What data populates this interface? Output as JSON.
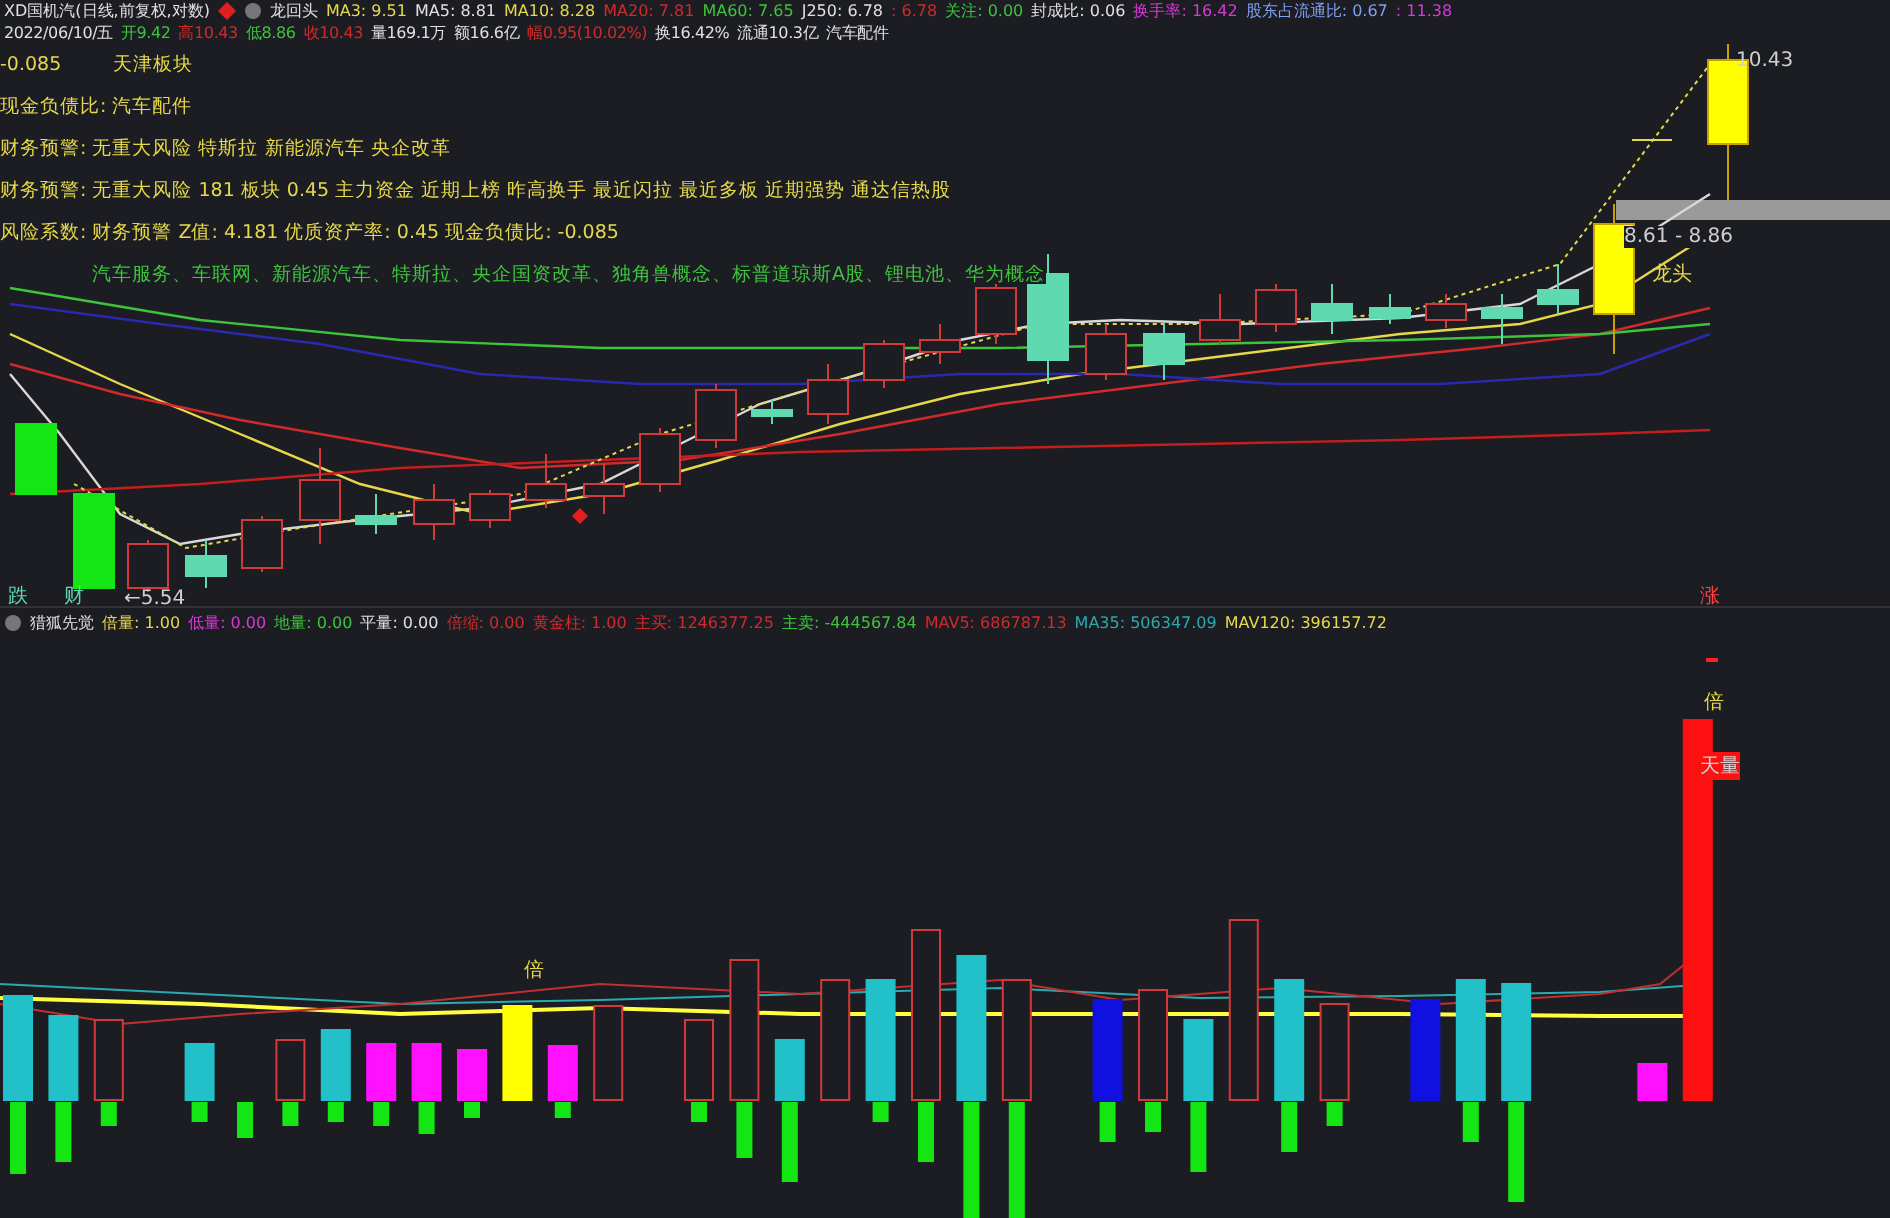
{
  "quote_bar": {
    "title": "XD国机汽(日线,前复权,对数)",
    "indicator": "龙回头",
    "items": [
      {
        "text": "MA3: 9.51",
        "color": "#e6d84a"
      },
      {
        "text": "MA5: 8.81",
        "color": "#e0e0e0"
      },
      {
        "text": "MA10: 8.28",
        "color": "#e6d84a"
      },
      {
        "text": "MA20: 7.81",
        "color": "#d02a2a"
      },
      {
        "text": "MA60: 7.65",
        "color": "#3cc43c"
      },
      {
        "text": "J250: 6.78",
        "color": "#e0e0e0"
      },
      {
        "text": ": 6.78",
        "color": "#d02a2a"
      },
      {
        "text": "关注: 0.00",
        "color": "#3cc43c"
      },
      {
        "text": "封成比: 0.06",
        "color": "#e0e0e0"
      },
      {
        "text": "换手率: 16.42",
        "color": "#d838d8"
      },
      {
        "text": "股东占流通比: 0.67",
        "color": "#7f9ff0"
      },
      {
        "text": ": 11.38",
        "color": "#d838d8"
      }
    ]
  },
  "day_bar": {
    "items": [
      {
        "text": "2022/06/10/五",
        "color": "#e0e0e0"
      },
      {
        "text": "开9.42",
        "color": "#3cc43c"
      },
      {
        "text": "高10.43",
        "color": "#d02a2a"
      },
      {
        "text": "低8.86",
        "color": "#3cc43c"
      },
      {
        "text": "收10.43",
        "color": "#d02a2a"
      },
      {
        "text": "量169.1万",
        "color": "#e0e0e0"
      },
      {
        "text": "额16.6亿",
        "color": "#e0e0e0"
      },
      {
        "text": "幅0.95(10.02%)",
        "color": "#d02a2a"
      },
      {
        "text": "换16.42%",
        "color": "#e0e0e0"
      },
      {
        "text": "流通10.3亿",
        "color": "#e0e0e0"
      },
      {
        "text": "汽车配件",
        "color": "#e0e0e0"
      }
    ]
  },
  "overlay_lines": [
    {
      "kind": "pair",
      "text": "-0.085",
      "extra": "天津板块"
    },
    {
      "kind": "line",
      "text": "现金负债比: 汽车配件"
    },
    {
      "kind": "line",
      "text": "财务预警: 无重大风险 特斯拉 新能源汽车 央企改革"
    },
    {
      "kind": "line",
      "text": "财务预警: 无重大风险 181 板块 0.45 主力资金 近期上榜 昨高换手 最近闪拉 最近多板 近期强势 通达信热股"
    },
    {
      "kind": "line",
      "text": "风险系数: 财务预警 Z值: 4.181 优质资产率: 0.45 现金负债比: -0.085"
    },
    {
      "kind": "concept",
      "text": "汽车服务、车联网、新能源汽车、特斯拉、央企国资改革、独角兽概念、标普道琼斯A股、锂电池、华为概念"
    }
  ],
  "chart_labels": {
    "high": "10.43",
    "range": "8.61 - 8.86",
    "low": "←5.54",
    "leader": "龙头",
    "fall": "跌",
    "finance": "财",
    "rise": "涨",
    "double_top": "倍",
    "double_mid": "倍",
    "huge_volume": "天量"
  },
  "indicator_bar": {
    "name": "猎狐先觉",
    "items": [
      {
        "text": "倍量: 1.00",
        "color": "#e6d84a"
      },
      {
        "text": "低量: 0.00",
        "color": "#d838d8"
      },
      {
        "text": "地量: 0.00",
        "color": "#3cc43c"
      },
      {
        "text": "平量: 0.00",
        "color": "#e0e0e0"
      },
      {
        "text": "倍缩: 0.00",
        "color": "#d02a2a"
      },
      {
        "text": "黄金柱: 1.00",
        "color": "#d02a2a"
      },
      {
        "text": "主买: 1246377.25",
        "color": "#d02a2a"
      },
      {
        "text": "主卖: -444567.84",
        "color": "#3cc43c"
      },
      {
        "text": "MAV5: 686787.13",
        "color": "#d02a2a"
      },
      {
        "text": "MA35: 506347.09",
        "color": "#2aaab0"
      },
      {
        "text": "MAV120: 396157.72",
        "color": "#e6d84a"
      }
    ]
  }
}
